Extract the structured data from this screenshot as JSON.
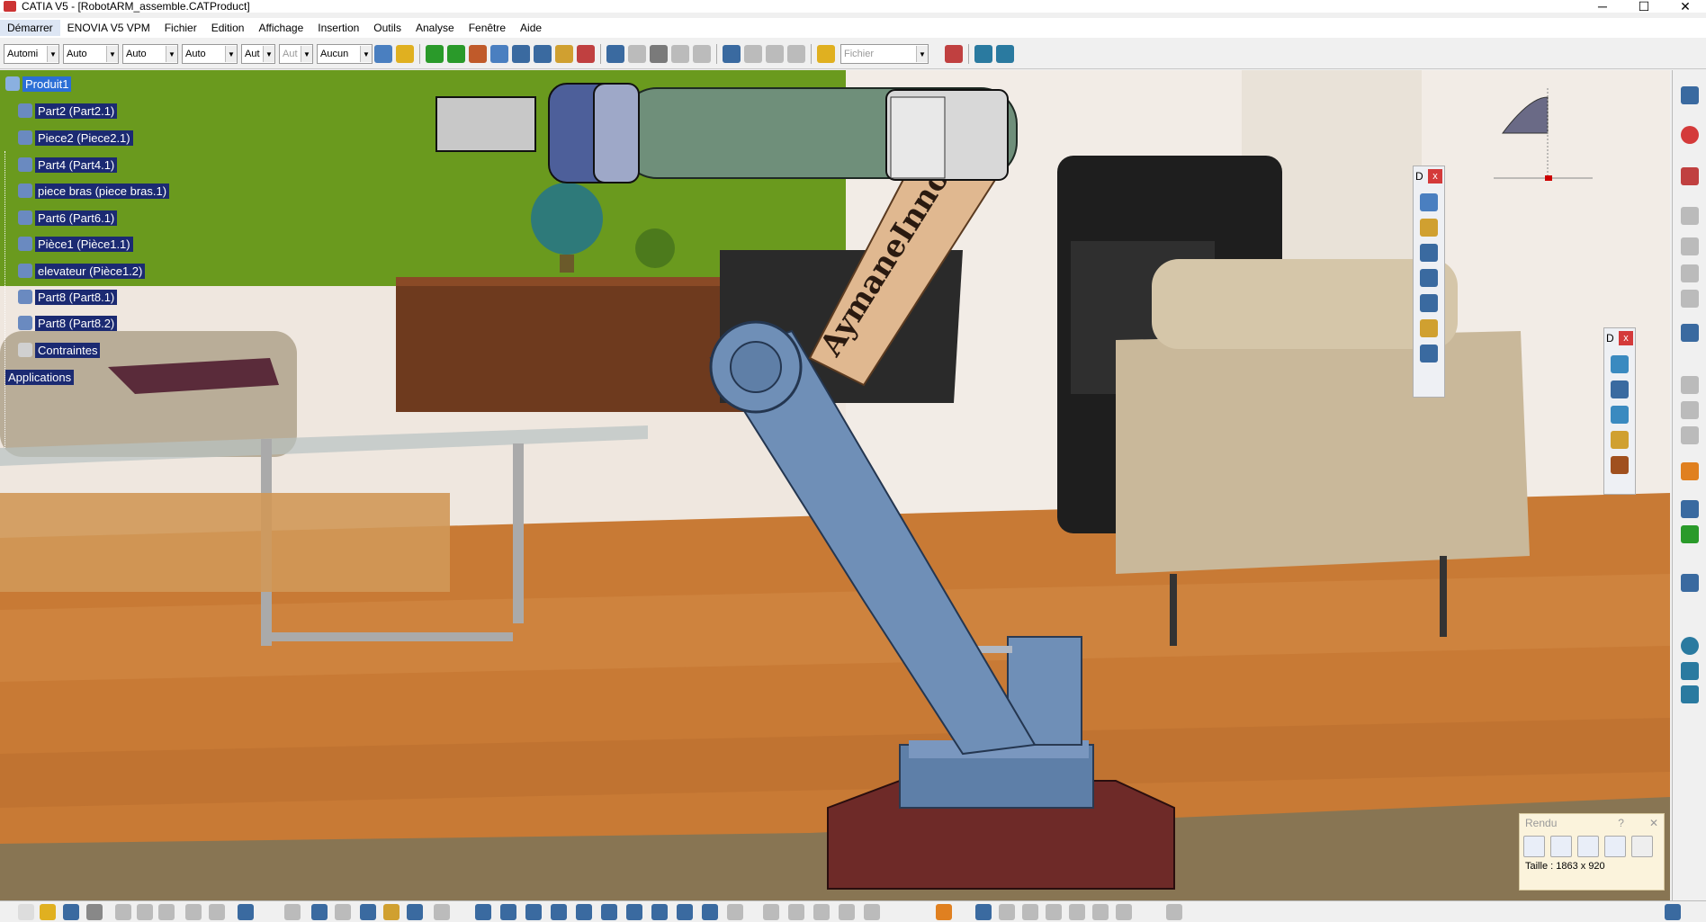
{
  "window": {
    "title": "CATIA V5 - [RobotARM_assemble.CATProduct]",
    "minimize": "─",
    "maximize": "☐",
    "close": "✕"
  },
  "menu": {
    "items": [
      "Démarrer",
      "ENOVIA V5 VPM",
      "Fichier",
      "Edition",
      "Affichage",
      "Insertion",
      "Outils",
      "Analyse",
      "Fenêtre",
      "Aide"
    ]
  },
  "toolbar": {
    "combo_1": "Automi",
    "combo_2": "Auto",
    "combo_3": "Auto",
    "combo_4": "Auto",
    "combo_5": "Aut",
    "combo_6": "Aut",
    "combo_7": "Aucun",
    "file_combo_placeholder": "Fichier"
  },
  "tree": {
    "root": "Produit1",
    "items": [
      "Part2 (Part2.1)",
      "Piece2 (Piece2.1)",
      "Part4 (Part4.1)",
      "piece bras (piece bras.1)",
      "Part6 (Part6.1)",
      "Pièce1 (Pièce1.1)",
      "elevateur (Pièce1.2)",
      "Part8 (Part8.1)",
      "Part8 (Part8.2)",
      "Contraintes"
    ],
    "applications": "Applications"
  },
  "model": {
    "arm_engraving": "AymaneInnoV"
  },
  "float_toolbar_1": {
    "title": "D",
    "close": "x"
  },
  "float_toolbar_2": {
    "title": "D",
    "close": "x"
  },
  "rendu": {
    "title": "Rendu",
    "help": "?",
    "close": "✕",
    "size_label": "Taille : 1863 x 920"
  },
  "colors": {
    "tree_label_bg": "#1b2a72",
    "selection_bg": "#2b6fd6",
    "wall_green": "#6a9a1e",
    "floor_wood": "#c87a35",
    "arm_blue": "#6f8fb7",
    "arm_tan": "#e0b890",
    "base_maroon": "#6e2a28"
  }
}
